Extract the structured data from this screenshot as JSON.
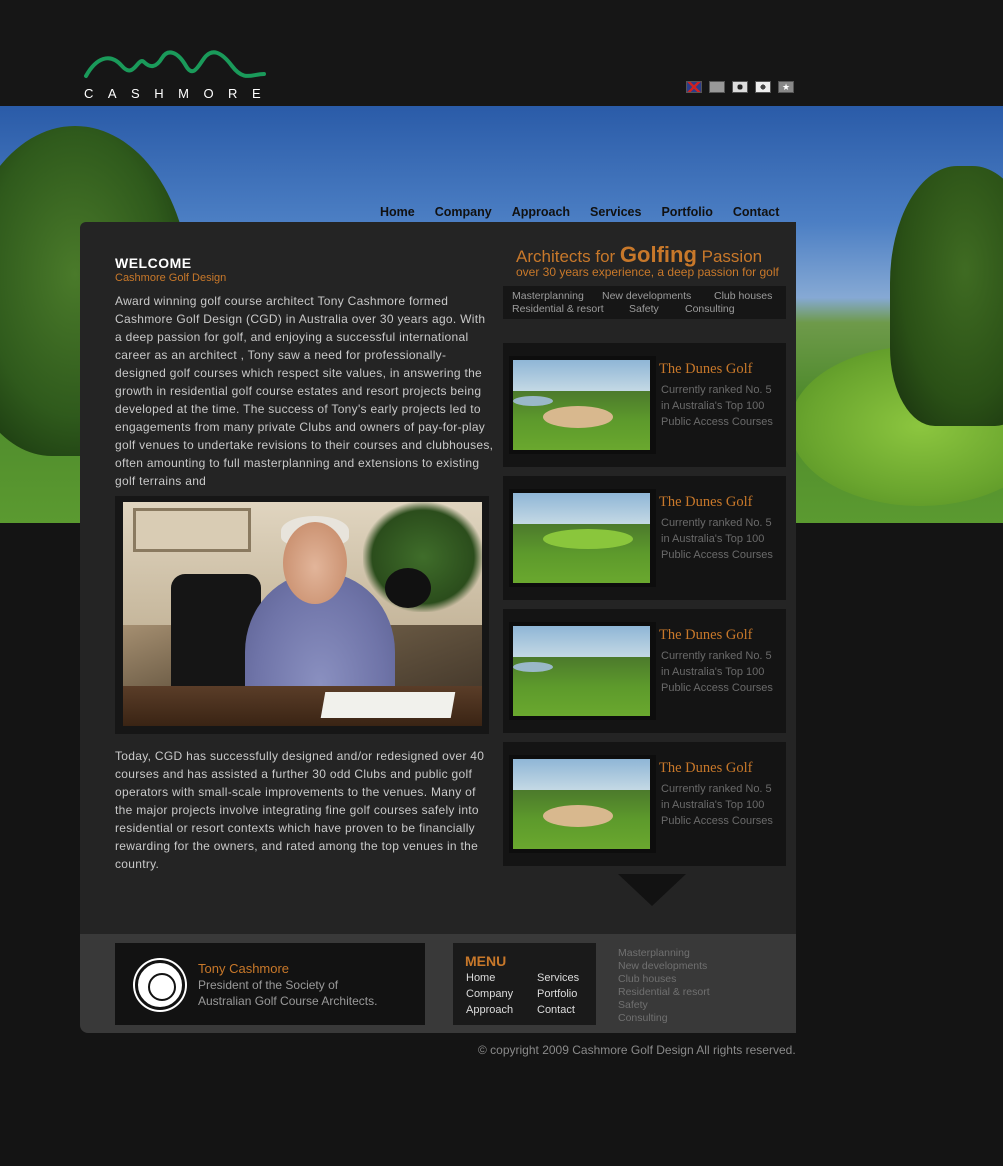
{
  "brand": {
    "logo_text": "CASHMORE",
    "accent_color": "#c8782a",
    "logo_color": "#1a9a5a"
  },
  "languages": [
    "english-flag-icon",
    "chinese-flag-icon",
    "japanese-flag-icon",
    "korean-flag-icon",
    "star-flag-icon"
  ],
  "nav": {
    "items": [
      "Home",
      "Company",
      "Approach",
      "Services",
      "Portfolio",
      "Contact"
    ]
  },
  "welcome": {
    "title": "WELCOME",
    "subtitle": "Cashmore Golf Design",
    "para1": "Award winning golf course architect Tony Cashmore formed Cashmore Golf Design (CGD) in Australia over 30 years ago. With a deep passion for golf, and enjoying a successful international career as an architect , Tony saw a need for professionally-designed golf courses which respect site values, in answering the growth in residential golf course estates and resort projects being developed at the time. The success of Tony's early projects led to engagements from many private Clubs and owners of pay-for-play golf venues to undertake revisions to their courses and clubhouses, often amounting to full masterplanning and extensions to existing golf terrains and",
    "para2": "Today, CGD has successfully designed and/or redesigned over 40 courses and has assisted a further 30 odd Clubs and public golf operators with small-scale improvements to the venues. Many of the major projects involve integrating fine golf courses safely into residential or resort contexts which have proven to be financially rewarding for the owners, and rated among the top venues in the country."
  },
  "tagline": {
    "prefix": "Architects for ",
    "highlight": "Golfing",
    "suffix": " Passion",
    "sub": "over 30 years experience, a deep passion for golf"
  },
  "service_bar": [
    "Masterplanning",
    "New developments",
    "Club houses",
    "Residential & resort",
    "Safety",
    "Consulting"
  ],
  "courses": [
    {
      "title": "The Dunes Golf",
      "line1": "Currently ranked No. 5",
      "line2": "in Australia's Top 100",
      "line3": "Public Access Courses"
    },
    {
      "title": "The Dunes Golf",
      "line1": "Currently ranked No. 5",
      "line2": "in Australia's Top 100",
      "line3": "Public Access Courses"
    },
    {
      "title": "The Dunes Golf",
      "line1": "Currently ranked No. 5",
      "line2": "in Australia's Top 100",
      "line3": "Public Access Courses"
    },
    {
      "title": "The Dunes Golf",
      "line1": "Currently ranked No. 5",
      "line2": "in Australia's Top 100",
      "line3": "Public Access Courses"
    }
  ],
  "footer": {
    "name": "Tony Cashmore",
    "role1": "President of the Society of",
    "role2": "Australian Golf Course Architects.",
    "menu_title": "MENU",
    "menu": [
      "Home",
      "Services",
      "Company",
      "Portfolio",
      "Approach",
      "Contact"
    ],
    "services": [
      "Masterplanning",
      "New developments",
      "Club houses",
      "Residential & resort",
      "Safety",
      "Consulting"
    ],
    "copyright": "© copyright 2009 Cashmore Golf Design All rights reserved."
  }
}
